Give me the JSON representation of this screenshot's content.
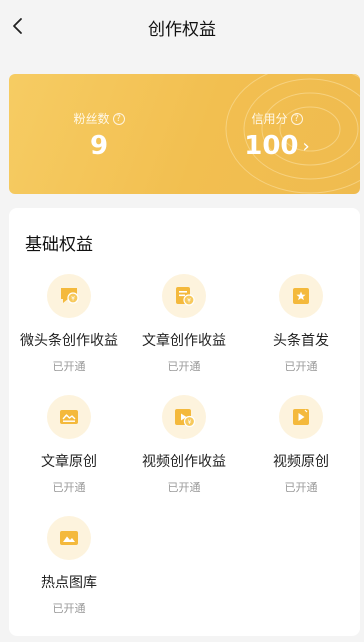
{
  "header": {
    "title": "创作权益"
  },
  "stats": {
    "fans": {
      "label": "粉丝数",
      "value": "9"
    },
    "credit": {
      "label": "信用分",
      "value": "100"
    }
  },
  "section": {
    "title": "基础权益",
    "items": [
      {
        "name": "微头条创作收益",
        "status": "已开通",
        "icon": "coin-message-icon"
      },
      {
        "name": "文章创作收益",
        "status": "已开通",
        "icon": "coin-article-icon"
      },
      {
        "name": "头条首发",
        "status": "已开通",
        "icon": "star-icon"
      },
      {
        "name": "文章原创",
        "status": "已开通",
        "icon": "original-article-icon"
      },
      {
        "name": "视频创作收益",
        "status": "已开通",
        "icon": "coin-video-icon"
      },
      {
        "name": "视频原创",
        "status": "已开通",
        "icon": "original-video-icon"
      },
      {
        "name": "热点图库",
        "status": "已开通",
        "icon": "image-gallery-icon"
      }
    ]
  },
  "colors": {
    "accent": "#f2bf50",
    "icon_bg": "#fdf3dd",
    "icon_fill": "#f4b93c"
  }
}
